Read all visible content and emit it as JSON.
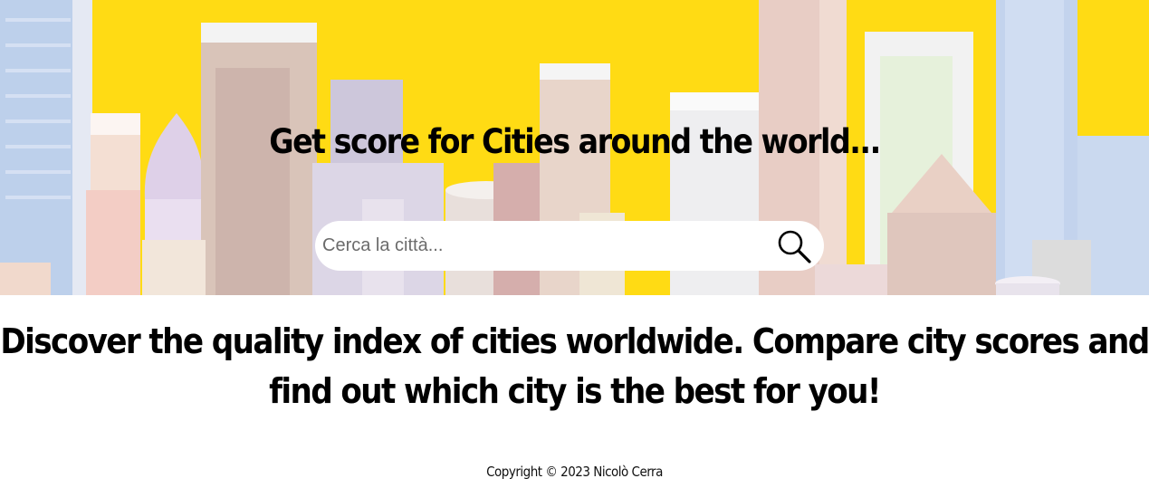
{
  "hero": {
    "title": "Get score for Cities around the world...",
    "background_color": "#FFD800"
  },
  "search": {
    "placeholder": "Cerca la città...",
    "value": "",
    "icon": "search-icon"
  },
  "main": {
    "tagline_line1": "Discover the quality index of cities worldwide. Compare city scores and",
    "tagline_line2": "find out which city is the best for you!"
  },
  "footer": {
    "copyright": "Copyright © 2023 Nicolò Cerra"
  }
}
